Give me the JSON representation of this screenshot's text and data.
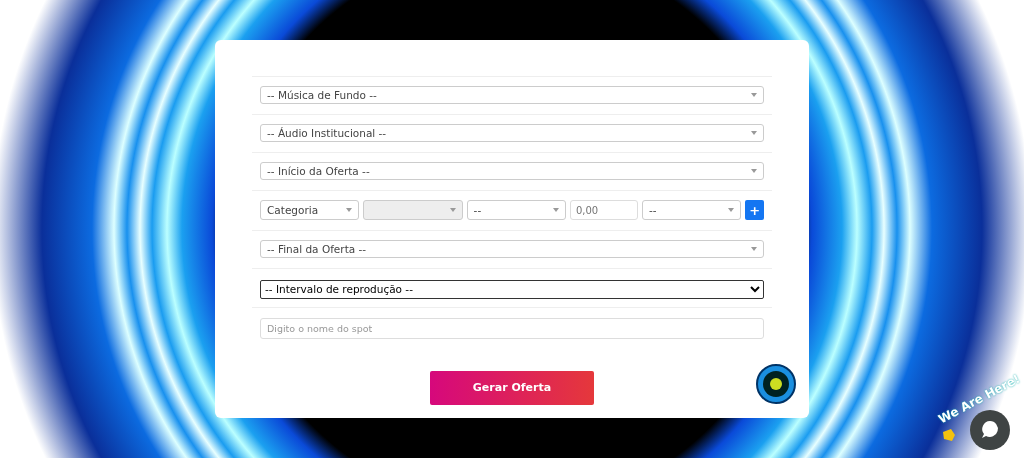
{
  "form": {
    "fields": [
      {
        "kind": "select",
        "value": "-- Música de Fundo --"
      },
      {
        "kind": "select",
        "value": "-- Áudio Institucional --"
      },
      {
        "kind": "select",
        "value": "-- Início da Oferta --"
      },
      {
        "kind": "row",
        "items": [
          {
            "kind": "select",
            "value": "Categoria",
            "disabled": false
          },
          {
            "kind": "select",
            "disabled": true
          },
          {
            "kind": "select",
            "value": "--",
            "disabled": false
          },
          {
            "kind": "number",
            "placeholder": "0,00",
            "disabled": false
          },
          {
            "kind": "select",
            "value": "--",
            "disabled": false
          },
          {
            "kind": "add",
            "label": "+",
            "disabled": false
          }
        ]
      },
      {
        "kind": "select",
        "value": "-- Final da Oferta --"
      },
      {
        "kind": "native",
        "value": "-- Intervalo de reprodução --"
      },
      {
        "kind": "input",
        "placeholder": "Digito o nome do spot"
      }
    ],
    "submit": "Gerar Oferta"
  },
  "chat": {
    "label": "We Are Here!"
  }
}
